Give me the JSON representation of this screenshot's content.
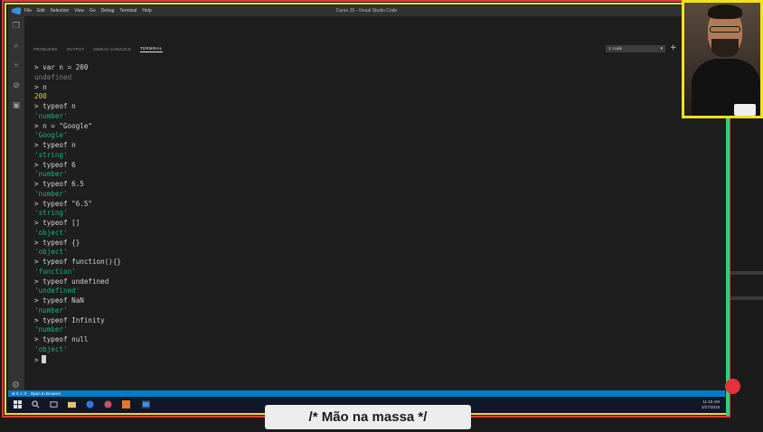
{
  "titlebar": {
    "menu": [
      "File",
      "Edit",
      "Selection",
      "View",
      "Go",
      "Debug",
      "Terminal",
      "Help"
    ],
    "title": "Curso JS - Visual Studio Code"
  },
  "panel": {
    "tabs": [
      "PROBLEMS",
      "OUTPUT",
      "DEBUG CONSOLE",
      "TERMINAL"
    ],
    "active_tab": "TERMINAL",
    "terminal_select": "1: node",
    "add_terminal": "+"
  },
  "terminal": {
    "lines": [
      {
        "type": "input",
        "text": "> var n = 200"
      },
      {
        "type": "undef",
        "text": "undefined"
      },
      {
        "type": "input",
        "text": "> n"
      },
      {
        "type": "num",
        "text": "200"
      },
      {
        "type": "input",
        "text": "> typeof n"
      },
      {
        "type": "string",
        "text": "'number'"
      },
      {
        "type": "input",
        "text": "> n = \"Google\""
      },
      {
        "type": "string",
        "text": "'Google'"
      },
      {
        "type": "input",
        "text": "> typeof n"
      },
      {
        "type": "string",
        "text": "'string'"
      },
      {
        "type": "input",
        "text": "> typeof 6"
      },
      {
        "type": "string",
        "text": "'number'"
      },
      {
        "type": "input",
        "text": "> typeof 6.5"
      },
      {
        "type": "string",
        "text": "'number'"
      },
      {
        "type": "input",
        "text": "> typeof \"6.5\""
      },
      {
        "type": "string",
        "text": "'string'"
      },
      {
        "type": "input",
        "text": "> typeof []"
      },
      {
        "type": "string",
        "text": "'object'"
      },
      {
        "type": "input",
        "text": "> typeof {}"
      },
      {
        "type": "string",
        "text": "'object'"
      },
      {
        "type": "input",
        "text": "> typeof function(){}"
      },
      {
        "type": "string",
        "text": "'function'"
      },
      {
        "type": "input",
        "text": "> typeof undefined"
      },
      {
        "type": "string",
        "text": "'undefined'"
      },
      {
        "type": "input",
        "text": "> typeof NaN"
      },
      {
        "type": "string",
        "text": "'number'"
      },
      {
        "type": "input",
        "text": "> typeof Infinity"
      },
      {
        "type": "string",
        "text": "'number'"
      },
      {
        "type": "input",
        "text": "> typeof null"
      },
      {
        "type": "string",
        "text": "'object'"
      }
    ],
    "prompt": ">"
  },
  "statusbar": {
    "problems": "⊗ 0 ⚠ 0",
    "open_in_browser": "Open In Browser"
  },
  "taskbar": {
    "time": "11:18 AM",
    "date": "2/27/2019"
  },
  "caption": "/* Mão na massa */",
  "colors": {
    "terminal_bg": "#1e1e1e",
    "string_green": "#18b36f",
    "number_yellow": "#d8c94a",
    "statusbar_blue": "#007acc",
    "frame_yellow": "#e8df2a",
    "frame_red": "#e03a3a"
  }
}
